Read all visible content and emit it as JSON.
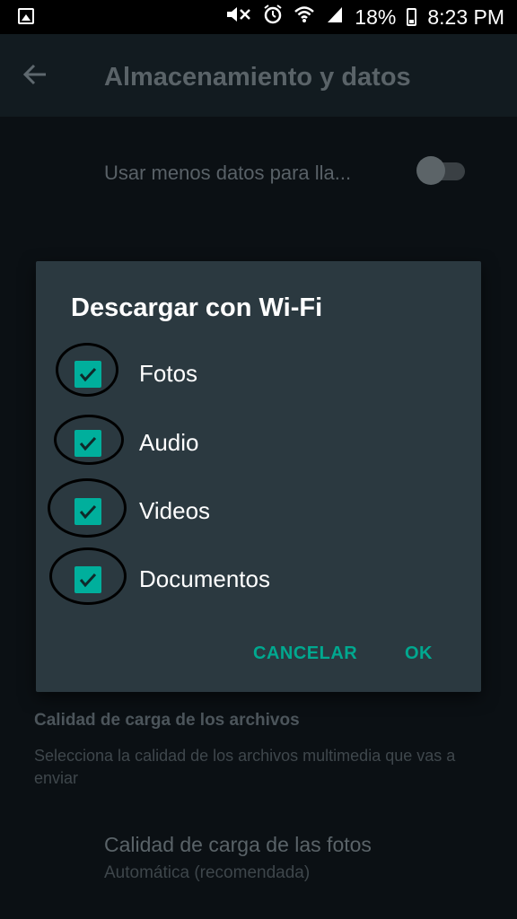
{
  "status_bar": {
    "battery_percent": "18%",
    "time": "8:23 PM",
    "icons": [
      "gallery-icon",
      "mute-icon",
      "alarm-icon",
      "wifi-icon",
      "signal-icon",
      "battery-icon"
    ]
  },
  "app_bar": {
    "back_icon": "back-arrow-icon",
    "title": "Almacenamiento y datos"
  },
  "background": {
    "low_data_label": "Usar menos datos para lla...",
    "low_data_toggle": "off",
    "section_header": "Calidad de carga de los archivos",
    "section_description": "Selecciona la calidad de los archivos multimedia que vas a enviar",
    "photo_quality_title": "Calidad de carga de las fotos",
    "photo_quality_value": "Automática (recomendada)"
  },
  "dialog": {
    "title": "Descargar con Wi-Fi",
    "options": [
      {
        "label": "Fotos",
        "checked": true
      },
      {
        "label": "Audio",
        "checked": true
      },
      {
        "label": "Videos",
        "checked": true
      },
      {
        "label": "Documentos",
        "checked": true
      }
    ],
    "cancel_label": "CANCELAR",
    "ok_label": "OK"
  },
  "colors": {
    "accent": "#00af9c",
    "dialog_bg": "#2b3940",
    "button_text": "#00a88f"
  }
}
